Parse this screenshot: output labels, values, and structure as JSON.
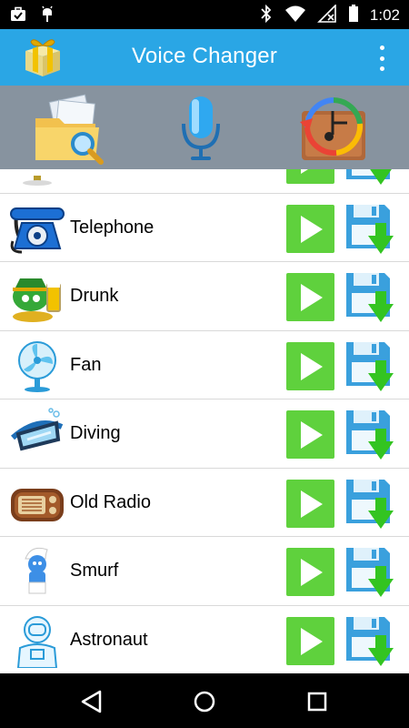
{
  "status_bar": {
    "time": "1:02",
    "left_icons": [
      "briefcase-check-icon",
      "android-debug-icon"
    ],
    "right_icons": [
      "bluetooth-icon",
      "wifi-icon",
      "signal-off-icon",
      "battery-icon"
    ]
  },
  "app": {
    "title": "Voice Changer",
    "menu_icon": "more-vertical-icon",
    "accent": "#2aa6e5"
  },
  "toolbar": {
    "items": [
      {
        "name": "open-file-icon"
      },
      {
        "name": "microphone-icon"
      },
      {
        "name": "history-music-icon"
      }
    ],
    "background": "#87939f"
  },
  "effects": [
    {
      "label": "",
      "icon": "lamp-icon"
    },
    {
      "label": "Telephone",
      "icon": "telephone-icon"
    },
    {
      "label": "Drunk",
      "icon": "drunk-icon"
    },
    {
      "label": "Fan",
      "icon": "fan-icon"
    },
    {
      "label": "Diving",
      "icon": "diving-mask-icon"
    },
    {
      "label": "Old Radio",
      "icon": "old-radio-icon"
    },
    {
      "label": "Smurf",
      "icon": "smurf-icon"
    },
    {
      "label": "Astronaut",
      "icon": "astronaut-icon"
    }
  ],
  "colors": {
    "play_button": "#5fd13d",
    "save_icon": "#3aa0dd"
  },
  "nav_bar": {
    "items": [
      "back-icon",
      "home-icon",
      "recents-icon"
    ]
  }
}
